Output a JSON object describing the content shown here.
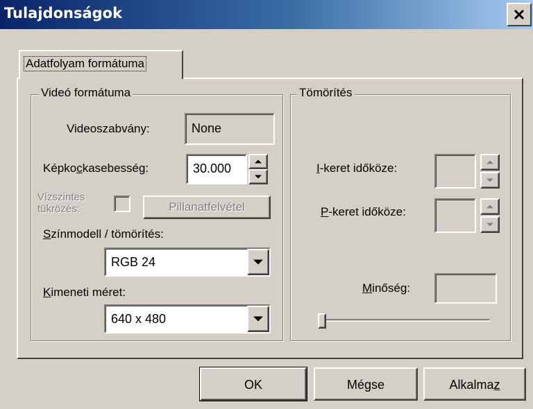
{
  "window": {
    "title": "Tulajdonságok"
  },
  "tabs": [
    {
      "label": "Adatfolyam formátuma"
    }
  ],
  "video_group": {
    "title": "Videó formátuma",
    "standard_label": "Videoszabvány:",
    "standard_value": "None",
    "framerate_label_pre": "Képko",
    "framerate_label_u": "c",
    "framerate_label_post": "kasebesség:",
    "framerate_value": "30.000",
    "flip_label_line1": "Vízszintes",
    "flip_label_line2": "tükrözés:",
    "flip_checked": false,
    "snapshot_label": "Pillanatfelvétel",
    "colormodel_label_u": "S",
    "colormodel_label_rest": "zínmodell / tömörítés:",
    "colormodel_value": "RGB 24",
    "output_size_label_u": "K",
    "output_size_label_rest": "imeneti méret:",
    "output_size_value": "640 x 480"
  },
  "compression_group": {
    "title": "Tömörítés",
    "iframe_label_u": "I",
    "iframe_label_rest": "-keret időköze:",
    "iframe_value": "",
    "pframe_label_u": "P",
    "pframe_label_rest": "-keret időköze:",
    "pframe_value": "",
    "quality_label_pre": "",
    "quality_label_u": "M",
    "quality_label_rest": "inőség:",
    "quality_value": "",
    "quality_slider_fraction": 0.0
  },
  "footer": {
    "ok_label": "OK",
    "cancel_label": "Mégse",
    "apply_label_pre": "Alkalma",
    "apply_label_u": "z"
  },
  "icons": {
    "close": "close-icon",
    "spin_up": "spin-up-arrow-icon",
    "spin_down": "spin-down-arrow-icon",
    "dropdown": "dropdown-arrow-icon"
  }
}
